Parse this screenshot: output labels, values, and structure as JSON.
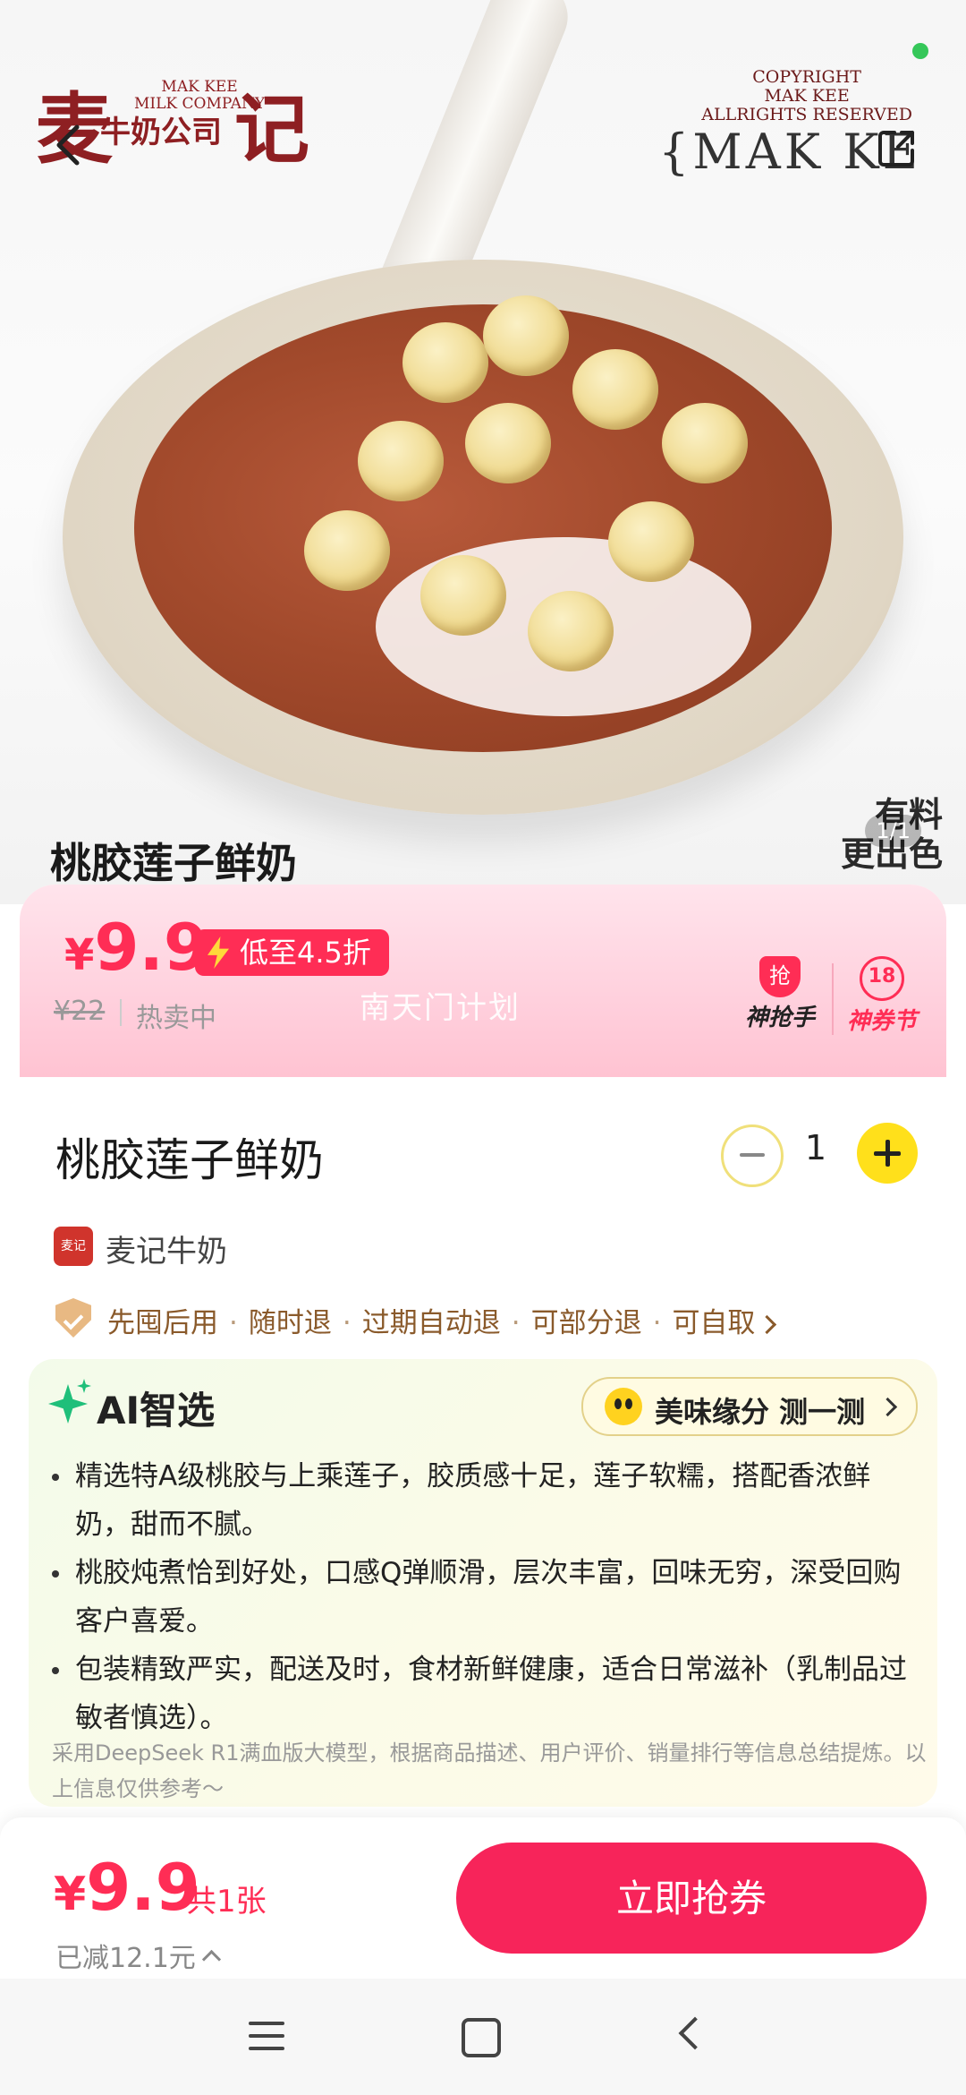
{
  "hero": {
    "brand_cn_mark": "麦",
    "brand_en": "MAK KEE\nMILK COMPANY",
    "brand_company_cn": "牛奶公司",
    "brand_ji": "记",
    "copyright": "COPYRIGHT\nMAK KEE\nALLRIGHTS RESERVED",
    "brand_mark": "{MAK KE",
    "title": "桃胶莲子鲜奶",
    "slogan": "有料\n更出色",
    "image_counter": "1/1"
  },
  "price_banner": {
    "currency": "¥",
    "price": "9.9",
    "discount": "低至4.5折",
    "original_price": "¥22",
    "status": "热卖中",
    "watermark": "南天门计划",
    "badge_grab": "神抢手",
    "badge_coupon": "神券节",
    "badge_coupon_icon_text": "18",
    "badge_grab_icon_text": "抢"
  },
  "product": {
    "name": "桃胶莲子鲜奶",
    "quantity": "1",
    "shop_name": "麦记牛奶",
    "guarantees": [
      "先囤后用",
      "随时退",
      "过期自动退",
      "可部分退",
      "可自取"
    ]
  },
  "ai": {
    "title": "AI智选",
    "taste_button": "美味缘分 测一测",
    "points": [
      "精选特A级桃胶与上乘莲子，胶质感十足，莲子软糯，搭配香浓鲜奶，甜而不腻。",
      "桃胶炖煮恰到好处，口感Q弹顺滑，层次丰富，回味无穷，深受回购客户喜爱。",
      "包装精致严实，配送及时，食材新鲜健康，适合日常滋补（乳制品过敏者慎选）。"
    ],
    "footnote": "采用DeepSeek R1满血版大模型，根据商品描述、用户评价、销量排行等信息总结提炼。以上信息仅供参考～"
  },
  "bottom": {
    "currency": "¥",
    "price": "9.9",
    "count": "共1张",
    "reduced": "已减12.1元",
    "button": "立即抢券"
  },
  "colors": {
    "accent": "#ff2d55",
    "button": "#f7245a",
    "brand": "#8e1f22",
    "ai_green": "#1fbf7a",
    "plus_yellow": "#ffe01b"
  }
}
